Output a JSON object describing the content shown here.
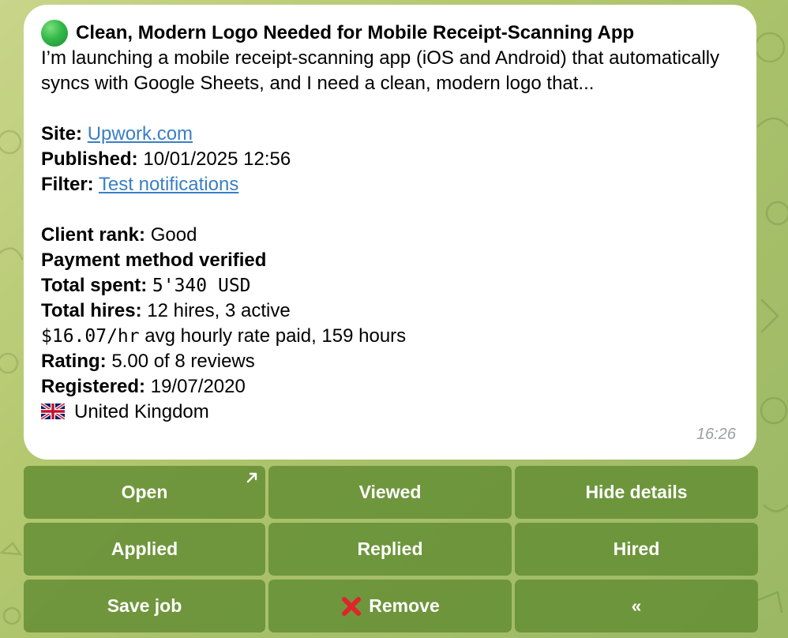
{
  "message": {
    "title": "Clean, Modern Logo Needed for Mobile Receipt-Scanning App",
    "description": "I’m launching a mobile receipt-scanning app (iOS and Android) that automatically syncs with Google Sheets, and I need a clean, modern logo that...",
    "site_label": "Site:",
    "site_value": "Upwork.com",
    "published_label": "Published:",
    "published_value": "10/01/2025 12:56",
    "filter_label": "Filter:",
    "filter_value": "Test notifications",
    "client_rank_label": "Client rank:",
    "client_rank_value": "Good",
    "payment_verified": "Payment method verified",
    "total_spent_label": "Total spent:",
    "total_spent_value": "5'340 USD",
    "total_hires_label": "Total hires:",
    "total_hires_value": "12 hires, 3 active",
    "hourly_rate_value": "$16.07/hr",
    "hourly_rate_text": "avg hourly rate paid, 159 hours",
    "rating_label": "Rating:",
    "rating_value": "5.00 of 8 reviews",
    "registered_label": "Registered:",
    "registered_value": "19/07/2020",
    "country": "United Kingdom",
    "time": "16:26",
    "title_icon": "green-circle-icon",
    "country_icon": "uk-flag-icon"
  },
  "keyboard": {
    "buttons": [
      {
        "label": "Open",
        "icon": "external-link-arrow-icon"
      },
      {
        "label": "Viewed"
      },
      {
        "label": "Hide details"
      },
      {
        "label": "Applied"
      },
      {
        "label": "Replied"
      },
      {
        "label": "Hired"
      },
      {
        "label": "Save job"
      },
      {
        "label": "Remove",
        "icon": "red-cross-icon"
      },
      {
        "label": "«"
      }
    ]
  },
  "colors": {
    "link": "#3a7fc4",
    "button_bg": "#628c32",
    "bubble_bg": "#ffffff",
    "time": "#9aa0a6"
  }
}
